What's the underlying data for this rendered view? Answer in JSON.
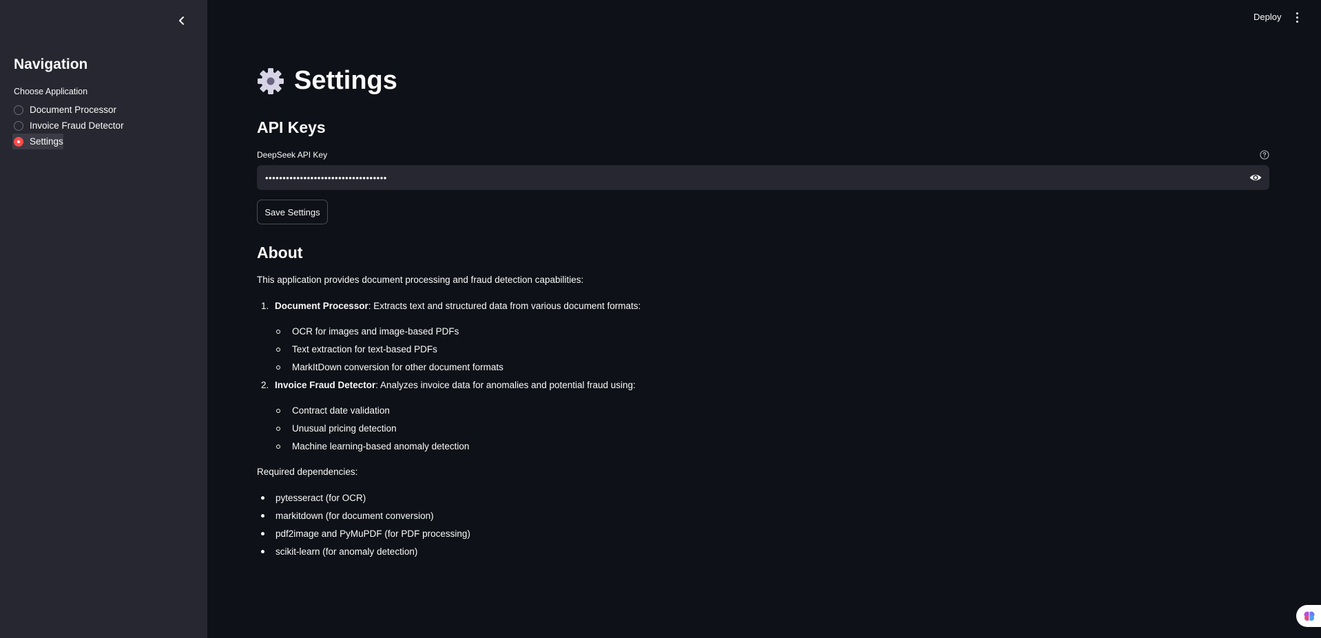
{
  "sidebar": {
    "title": "Navigation",
    "radio_label": "Choose Application",
    "options": [
      {
        "label": "Document Processor",
        "selected": false
      },
      {
        "label": "Invoice Fraud Detector",
        "selected": false
      },
      {
        "label": "Settings",
        "selected": true
      }
    ]
  },
  "header": {
    "deploy_label": "Deploy"
  },
  "main": {
    "title": "Settings",
    "title_icon": "gear-icon",
    "api_section": {
      "heading": "API Keys",
      "field_label": "DeepSeek API Key",
      "field_value": "•••••••••••••••••••••••••••••••••••",
      "save_label": "Save Settings"
    },
    "about": {
      "heading": "About",
      "intro": "This application provides document processing and fraud detection capabilities:",
      "items": [
        {
          "num": "1.",
          "title": "Document Processor",
          "desc": ": Extracts text and structured data from various document formats:",
          "subs": [
            "OCR for images and image-based PDFs",
            "Text extraction for text-based PDFs",
            "MarkItDown conversion for other document formats"
          ]
        },
        {
          "num": "2.",
          "title": "Invoice Fraud Detector",
          "desc": ": Analyzes invoice data for anomalies and potential fraud using:",
          "subs": [
            "Contract date validation",
            "Unusual pricing detection",
            "Machine learning-based anomaly detection"
          ]
        }
      ],
      "deps_label": "Required dependencies:",
      "deps": [
        "pytesseract (for OCR)",
        "markitdown (for document conversion)",
        "pdf2image and PyMuPDF (for PDF processing)",
        "scikit-learn (for anomaly detection)"
      ]
    }
  },
  "colors": {
    "background": "#0e1117",
    "sidebar": "#262730",
    "accent": "#ff4b4b",
    "text": "#fafafa"
  }
}
